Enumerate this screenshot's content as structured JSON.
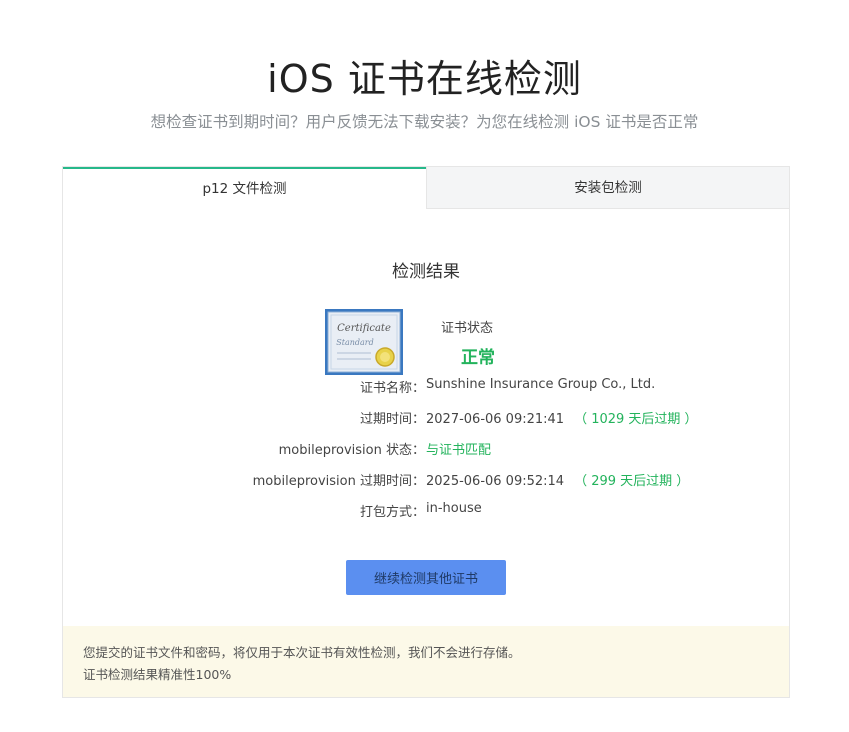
{
  "header": {
    "title": "iOS 证书在线检测",
    "subtitle": "想检查证书到期时间？用户反馈无法下载安装？为您在线检测 iOS 证书是否正常"
  },
  "tabs": [
    {
      "label": "p12 文件检测",
      "active": true
    },
    {
      "label": "安装包检测",
      "active": false
    }
  ],
  "result": {
    "title": "检测结果",
    "cert_icon_text": [
      "Certificate",
      "Standard"
    ],
    "status_label": "证书状态",
    "status_value": "正常",
    "rows": [
      {
        "label": "证书名称：",
        "value": "Sunshine Insurance Group Co., Ltd.",
        "note": ""
      },
      {
        "label": "过期时间：",
        "value": "2027-06-06 09:21:41",
        "note": "（ 1029 天后过期 ）"
      },
      {
        "label": "mobileprovision 状态：",
        "value": "与证书匹配",
        "note": ""
      },
      {
        "label": "mobileprovision 过期时间：",
        "value": "2025-06-06 09:52:14",
        "note": "（ 299 天后过期 ）"
      },
      {
        "label": "打包方式：",
        "value": "in-house",
        "note": ""
      }
    ],
    "continue_button": "继续检测其他证书"
  },
  "notice": {
    "line1": "您提交的证书文件和密码，将仅用于本次证书有效性检测，我们不会进行存储。",
    "line2": "证书检测结果精准性100%"
  },
  "colors": {
    "accent": "#26b88a",
    "status_green": "#23b35c",
    "button_blue": "#5b8ff0",
    "notice_bg": "#fcf9e8"
  }
}
